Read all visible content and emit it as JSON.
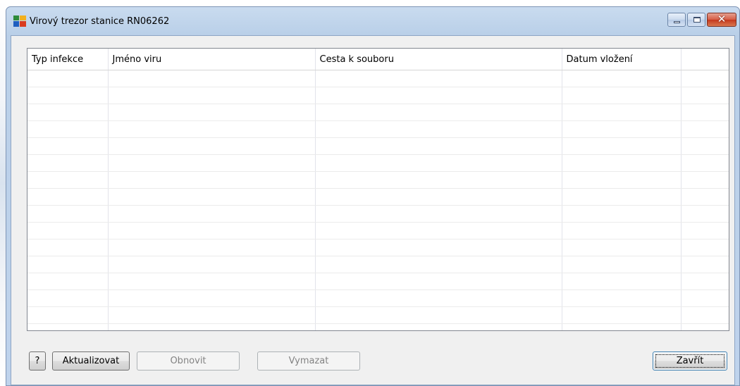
{
  "window": {
    "title": "Virový trezor stanice RN06262",
    "icon": "avg-logo-icon",
    "caption_buttons": [
      "minimize-icon",
      "maximize-icon",
      "close-icon"
    ]
  },
  "table": {
    "columns": [
      "Typ infekce",
      "Jméno viru",
      "Cesta k souboru",
      "Datum vložení",
      ""
    ],
    "rows": []
  },
  "buttons": {
    "help": "?",
    "update": "Aktualizovat",
    "restore": "Obnovit",
    "delete": "Vymazat",
    "close": "Zavřít"
  },
  "colors": {
    "frame": "#bfd3ec",
    "client": "#f0f0f0",
    "close_button": "#c5381d"
  }
}
